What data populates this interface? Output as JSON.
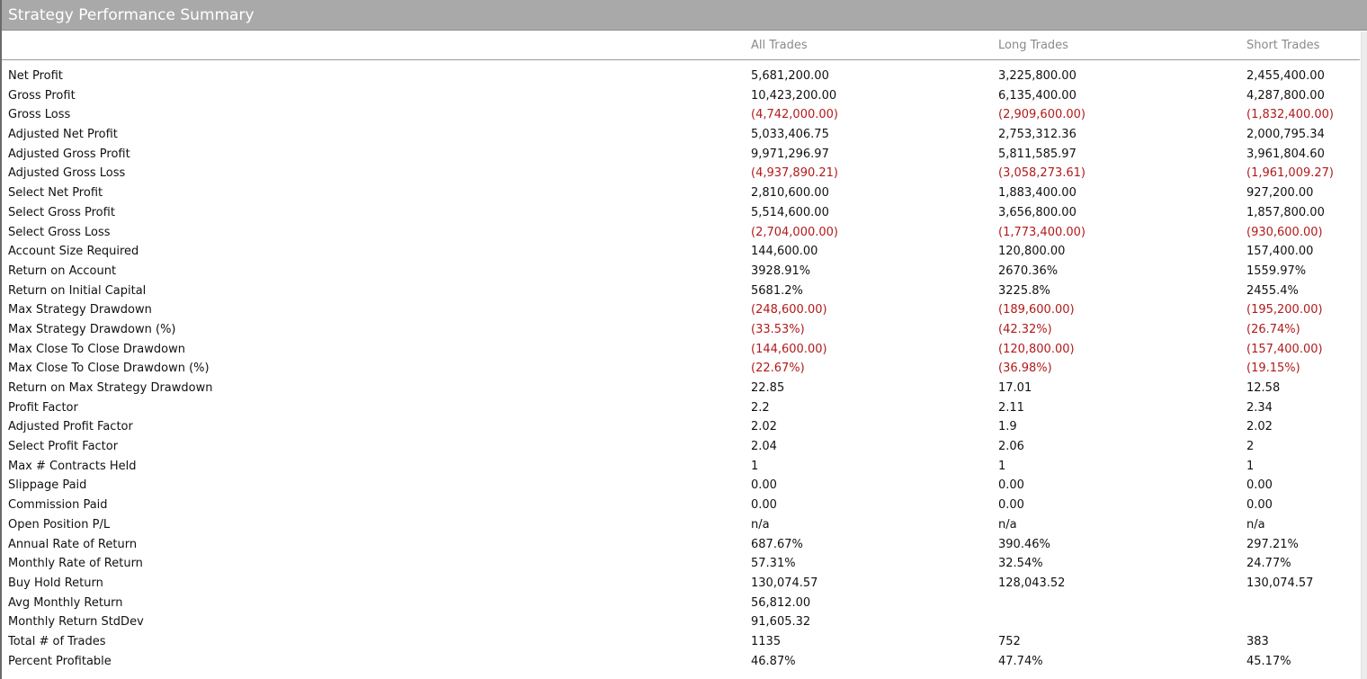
{
  "title": "Strategy Performance Summary",
  "columns": [
    "All Trades",
    "Long Trades",
    "Short Trades"
  ],
  "rows": [
    {
      "label": "Net Profit",
      "all": "5,681,200.00",
      "long": "3,225,800.00",
      "short": "2,455,400.00"
    },
    {
      "label": "Gross Profit",
      "all": "10,423,200.00",
      "long": "6,135,400.00",
      "short": "4,287,800.00"
    },
    {
      "label": "Gross Loss",
      "all": "(4,742,000.00)",
      "long": "(2,909,600.00)",
      "short": "(1,832,400.00)"
    },
    {
      "label": "Adjusted Net Profit",
      "all": "5,033,406.75",
      "long": "2,753,312.36",
      "short": "2,000,795.34"
    },
    {
      "label": "Adjusted Gross Profit",
      "all": "9,971,296.97",
      "long": "5,811,585.97",
      "short": "3,961,804.60"
    },
    {
      "label": "Adjusted Gross Loss",
      "all": "(4,937,890.21)",
      "long": "(3,058,273.61)",
      "short": "(1,961,009.27)"
    },
    {
      "label": "Select Net Profit",
      "all": "2,810,600.00",
      "long": "1,883,400.00",
      "short": "927,200.00"
    },
    {
      "label": "Select Gross Profit",
      "all": "5,514,600.00",
      "long": "3,656,800.00",
      "short": "1,857,800.00"
    },
    {
      "label": "Select Gross Loss",
      "all": "(2,704,000.00)",
      "long": "(1,773,400.00)",
      "short": "(930,600.00)"
    },
    {
      "label": "Account Size Required",
      "all": "144,600.00",
      "long": "120,800.00",
      "short": "157,400.00"
    },
    {
      "label": "Return on Account",
      "all": "3928.91%",
      "long": "2670.36%",
      "short": "1559.97%"
    },
    {
      "label": "Return on Initial Capital",
      "all": "5681.2%",
      "long": "3225.8%",
      "short": "2455.4%"
    },
    {
      "label": "Max Strategy Drawdown",
      "all": "(248,600.00)",
      "long": "(189,600.00)",
      "short": "(195,200.00)"
    },
    {
      "label": "Max Strategy Drawdown (%)",
      "all": "(33.53%)",
      "long": "(42.32%)",
      "short": "(26.74%)"
    },
    {
      "label": "Max Close To Close Drawdown",
      "all": "(144,600.00)",
      "long": "(120,800.00)",
      "short": "(157,400.00)"
    },
    {
      "label": "Max Close To Close Drawdown (%)",
      "all": "(22.67%)",
      "long": "(36.98%)",
      "short": "(19.15%)"
    },
    {
      "label": "Return on Max Strategy Drawdown",
      "all": "22.85",
      "long": "17.01",
      "short": "12.58"
    },
    {
      "label": "Profit Factor",
      "all": "2.2",
      "long": "2.11",
      "short": "2.34"
    },
    {
      "label": "Adjusted Profit Factor",
      "all": "2.02",
      "long": "1.9",
      "short": "2.02"
    },
    {
      "label": "Select Profit Factor",
      "all": "2.04",
      "long": "2.06",
      "short": "2"
    },
    {
      "label": "Max # Contracts Held",
      "all": "1",
      "long": "1",
      "short": "1"
    },
    {
      "label": "Slippage Paid",
      "all": "0.00",
      "long": "0.00",
      "short": "0.00"
    },
    {
      "label": "Commission Paid",
      "all": "0.00",
      "long": "0.00",
      "short": "0.00"
    },
    {
      "label": "Open Position P/L",
      "all": "n/a",
      "long": "n/a",
      "short": "n/a"
    },
    {
      "label": "Annual Rate of Return",
      "all": "687.67%",
      "long": "390.46%",
      "short": "297.21%"
    },
    {
      "label": "Monthly Rate of Return",
      "all": "57.31%",
      "long": "32.54%",
      "short": "24.77%"
    },
    {
      "label": "Buy  Hold Return",
      "all": "130,074.57",
      "long": "128,043.52",
      "short": "130,074.57"
    },
    {
      "label": "Avg Monthly Return",
      "all": "56,812.00",
      "long": "",
      "short": ""
    },
    {
      "label": "Monthly Return StdDev",
      "all": "91,605.32",
      "long": "",
      "short": ""
    },
    {
      "label": "Total # of Trades",
      "all": "1135",
      "long": "752",
      "short": "383"
    },
    {
      "label": "Percent Profitable",
      "all": "46.87%",
      "long": "47.74%",
      "short": "45.17%"
    }
  ],
  "colors": {
    "negative": "#b21a1a",
    "title_bar": "#a9a9a9",
    "header_text": "#8a8a8a"
  }
}
